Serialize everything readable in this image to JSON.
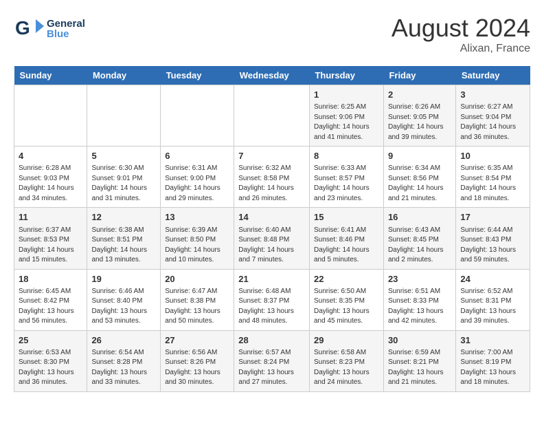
{
  "header": {
    "logo_general": "General",
    "logo_blue": "Blue",
    "month": "August 2024",
    "location": "Alixan, France"
  },
  "days_of_week": [
    "Sunday",
    "Monday",
    "Tuesday",
    "Wednesday",
    "Thursday",
    "Friday",
    "Saturday"
  ],
  "weeks": [
    [
      {
        "day": "",
        "info": ""
      },
      {
        "day": "",
        "info": ""
      },
      {
        "day": "",
        "info": ""
      },
      {
        "day": "",
        "info": ""
      },
      {
        "day": "1",
        "info": "Sunrise: 6:25 AM\nSunset: 9:06 PM\nDaylight: 14 hours\nand 41 minutes."
      },
      {
        "day": "2",
        "info": "Sunrise: 6:26 AM\nSunset: 9:05 PM\nDaylight: 14 hours\nand 39 minutes."
      },
      {
        "day": "3",
        "info": "Sunrise: 6:27 AM\nSunset: 9:04 PM\nDaylight: 14 hours\nand 36 minutes."
      }
    ],
    [
      {
        "day": "4",
        "info": "Sunrise: 6:28 AM\nSunset: 9:03 PM\nDaylight: 14 hours\nand 34 minutes."
      },
      {
        "day": "5",
        "info": "Sunrise: 6:30 AM\nSunset: 9:01 PM\nDaylight: 14 hours\nand 31 minutes."
      },
      {
        "day": "6",
        "info": "Sunrise: 6:31 AM\nSunset: 9:00 PM\nDaylight: 14 hours\nand 29 minutes."
      },
      {
        "day": "7",
        "info": "Sunrise: 6:32 AM\nSunset: 8:58 PM\nDaylight: 14 hours\nand 26 minutes."
      },
      {
        "day": "8",
        "info": "Sunrise: 6:33 AM\nSunset: 8:57 PM\nDaylight: 14 hours\nand 23 minutes."
      },
      {
        "day": "9",
        "info": "Sunrise: 6:34 AM\nSunset: 8:56 PM\nDaylight: 14 hours\nand 21 minutes."
      },
      {
        "day": "10",
        "info": "Sunrise: 6:35 AM\nSunset: 8:54 PM\nDaylight: 14 hours\nand 18 minutes."
      }
    ],
    [
      {
        "day": "11",
        "info": "Sunrise: 6:37 AM\nSunset: 8:53 PM\nDaylight: 14 hours\nand 15 minutes."
      },
      {
        "day": "12",
        "info": "Sunrise: 6:38 AM\nSunset: 8:51 PM\nDaylight: 14 hours\nand 13 minutes."
      },
      {
        "day": "13",
        "info": "Sunrise: 6:39 AM\nSunset: 8:50 PM\nDaylight: 14 hours\nand 10 minutes."
      },
      {
        "day": "14",
        "info": "Sunrise: 6:40 AM\nSunset: 8:48 PM\nDaylight: 14 hours\nand 7 minutes."
      },
      {
        "day": "15",
        "info": "Sunrise: 6:41 AM\nSunset: 8:46 PM\nDaylight: 14 hours\nand 5 minutes."
      },
      {
        "day": "16",
        "info": "Sunrise: 6:43 AM\nSunset: 8:45 PM\nDaylight: 14 hours\nand 2 minutes."
      },
      {
        "day": "17",
        "info": "Sunrise: 6:44 AM\nSunset: 8:43 PM\nDaylight: 13 hours\nand 59 minutes."
      }
    ],
    [
      {
        "day": "18",
        "info": "Sunrise: 6:45 AM\nSunset: 8:42 PM\nDaylight: 13 hours\nand 56 minutes."
      },
      {
        "day": "19",
        "info": "Sunrise: 6:46 AM\nSunset: 8:40 PM\nDaylight: 13 hours\nand 53 minutes."
      },
      {
        "day": "20",
        "info": "Sunrise: 6:47 AM\nSunset: 8:38 PM\nDaylight: 13 hours\nand 50 minutes."
      },
      {
        "day": "21",
        "info": "Sunrise: 6:48 AM\nSunset: 8:37 PM\nDaylight: 13 hours\nand 48 minutes."
      },
      {
        "day": "22",
        "info": "Sunrise: 6:50 AM\nSunset: 8:35 PM\nDaylight: 13 hours\nand 45 minutes."
      },
      {
        "day": "23",
        "info": "Sunrise: 6:51 AM\nSunset: 8:33 PM\nDaylight: 13 hours\nand 42 minutes."
      },
      {
        "day": "24",
        "info": "Sunrise: 6:52 AM\nSunset: 8:31 PM\nDaylight: 13 hours\nand 39 minutes."
      }
    ],
    [
      {
        "day": "25",
        "info": "Sunrise: 6:53 AM\nSunset: 8:30 PM\nDaylight: 13 hours\nand 36 minutes."
      },
      {
        "day": "26",
        "info": "Sunrise: 6:54 AM\nSunset: 8:28 PM\nDaylight: 13 hours\nand 33 minutes."
      },
      {
        "day": "27",
        "info": "Sunrise: 6:56 AM\nSunset: 8:26 PM\nDaylight: 13 hours\nand 30 minutes."
      },
      {
        "day": "28",
        "info": "Sunrise: 6:57 AM\nSunset: 8:24 PM\nDaylight: 13 hours\nand 27 minutes."
      },
      {
        "day": "29",
        "info": "Sunrise: 6:58 AM\nSunset: 8:23 PM\nDaylight: 13 hours\nand 24 minutes."
      },
      {
        "day": "30",
        "info": "Sunrise: 6:59 AM\nSunset: 8:21 PM\nDaylight: 13 hours\nand 21 minutes."
      },
      {
        "day": "31",
        "info": "Sunrise: 7:00 AM\nSunset: 8:19 PM\nDaylight: 13 hours\nand 18 minutes."
      }
    ]
  ]
}
